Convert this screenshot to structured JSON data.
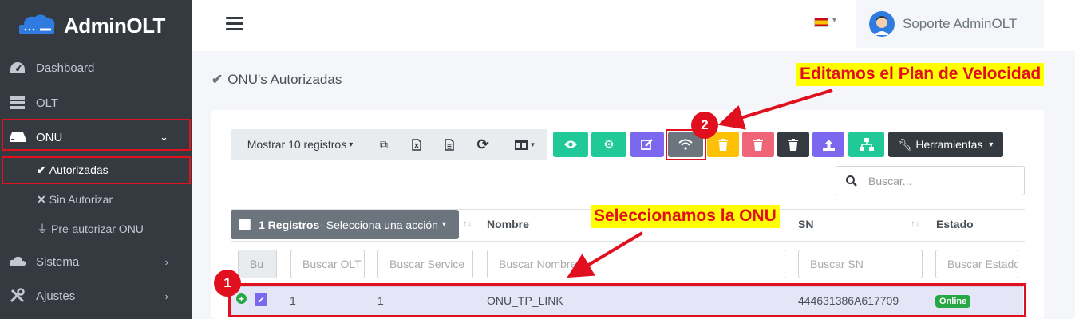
{
  "brand": {
    "name": "AdminOLT"
  },
  "sidebar": {
    "items": [
      {
        "label": "Dashboard",
        "icon": "dashboard-icon"
      },
      {
        "label": "OLT",
        "icon": "server-icon"
      },
      {
        "label": "ONU",
        "icon": "router-icon"
      },
      {
        "label": "Sistema",
        "icon": "cloud-icon"
      },
      {
        "label": "Ajustes",
        "icon": "tools-icon"
      }
    ],
    "sub_items": [
      {
        "label": "Autorizadas",
        "icon": "check-icon"
      },
      {
        "label": "Sin Autorizar",
        "icon": "times-icon"
      },
      {
        "label": "Pre-autorizar ONU",
        "icon": "plug-icon"
      }
    ]
  },
  "header": {
    "user_name": "Soporte AdminOLT",
    "language_flag": "es-flag-icon"
  },
  "page": {
    "title": "ONU's Autorizadas"
  },
  "toolbar": {
    "show_records": "Mostrar 10 registros",
    "tools_label": "Herramientas",
    "colors": {
      "green": "#20c997",
      "purple": "#7b68ee",
      "grey": "#6c757d",
      "yellow": "#ffc107",
      "pink": "#f06478",
      "dark": "#343a40"
    }
  },
  "search": {
    "placeholder": "Buscar..."
  },
  "table": {
    "select_bold": "1 Registros",
    "select_action": " - Selecciona una acción",
    "headers": {
      "nombre": "Nombre",
      "sn": "SN",
      "estado": "Estado"
    },
    "filters": {
      "first": "Bu",
      "olt": "Buscar OLT",
      "service": "Buscar Service",
      "nombre": "Buscar Nombre",
      "sn": "Buscar SN",
      "estado": "Buscar Estado"
    },
    "row": {
      "col1": "1",
      "col2": "1",
      "nombre": "ONU_TP_LINK",
      "sn": "444631386A617709",
      "estado": "Online"
    }
  },
  "annotations": {
    "edit_speed": "Editamos el Plan de Velocidad",
    "select_onu": "Seleccionamos la ONU",
    "step1": "1",
    "step2": "2"
  }
}
